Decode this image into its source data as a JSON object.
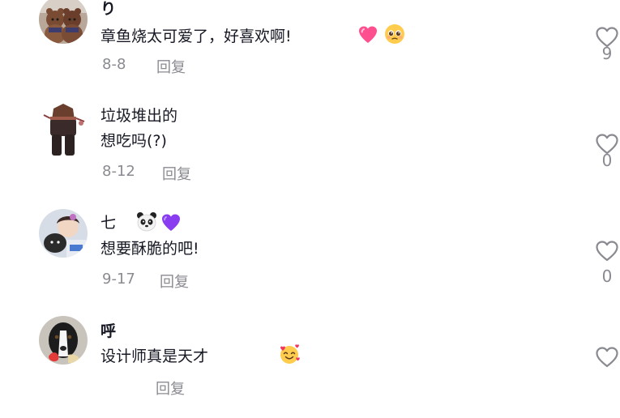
{
  "comments": [
    {
      "username": "り",
      "text": "章鱼烧太可爱了，好喜欢啊!",
      "emojis": [
        "sparkling-heart-emoji",
        "pleading-face-emoji"
      ],
      "date": "8-8",
      "reply_label": "回复",
      "likes": "9"
    },
    {
      "username": "垃圾堆出的",
      "text": "想吃吗(?)",
      "emojis": [],
      "date": "8-12",
      "reply_label": "回复",
      "likes": "0"
    },
    {
      "username": "七",
      "text": "想要酥脆的吧!",
      "emojis": [
        "panda-emoji",
        "purple-heart-emoji"
      ],
      "date": "9-17",
      "reply_label": "回复",
      "likes": "0"
    },
    {
      "username": "呼",
      "text": "设计师真是天才",
      "emojis": [
        "smiling-face-with-hearts-emoji"
      ],
      "date": "",
      "reply_label": "回复",
      "likes": ""
    }
  ],
  "colors": {
    "text_primary": "#161823",
    "text_secondary": "#8a8b91",
    "background": "#ffffff"
  },
  "icons": [
    "heart-outline-icon"
  ]
}
